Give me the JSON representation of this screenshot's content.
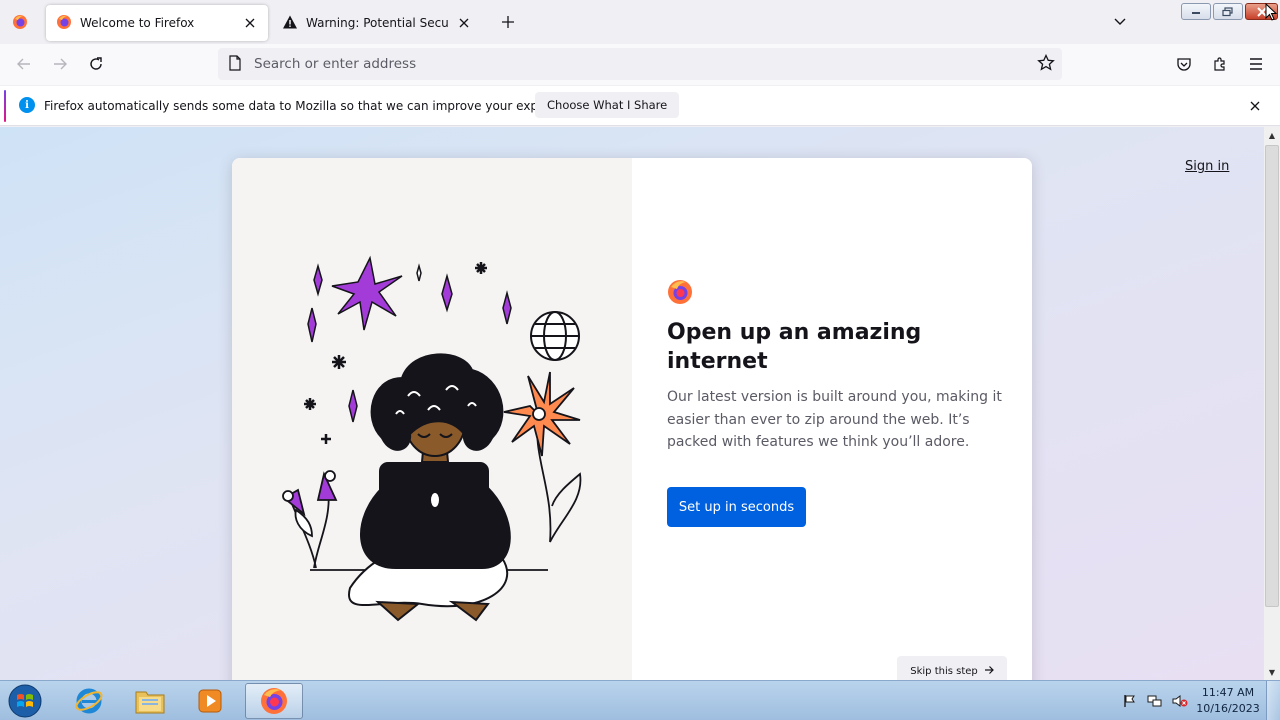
{
  "tabs": [
    {
      "title": "Welcome to Firefox",
      "icon": "firefox-icon",
      "active": true
    },
    {
      "title": "Warning: Potential Security Risk Ahead",
      "icon": "warning-icon",
      "active": false
    }
  ],
  "navbar": {
    "url_placeholder": "Search or enter address"
  },
  "notification": {
    "message": "Firefox automatically sends some data to Mozilla so that we can improve your experience.",
    "button_label": "Choose What I Share"
  },
  "page": {
    "sign_in": "Sign in",
    "headline": "Open up an amazing internet",
    "subtext": "Our latest version is built around you, making it easier than ever to zip around the web. It’s packed with features we think you’ll adore.",
    "primary_button": "Set up in seconds",
    "skip_button": "Skip this step"
  },
  "taskbar": {
    "items": [
      "internet-explorer",
      "file-explorer",
      "media-player",
      "firefox"
    ],
    "time": "11:47 AM",
    "date": "10/16/2023"
  },
  "colors": {
    "primary_button": "#0061e0",
    "accent_purple": "#a33bd9",
    "accent_orange": "#ff8a50"
  }
}
